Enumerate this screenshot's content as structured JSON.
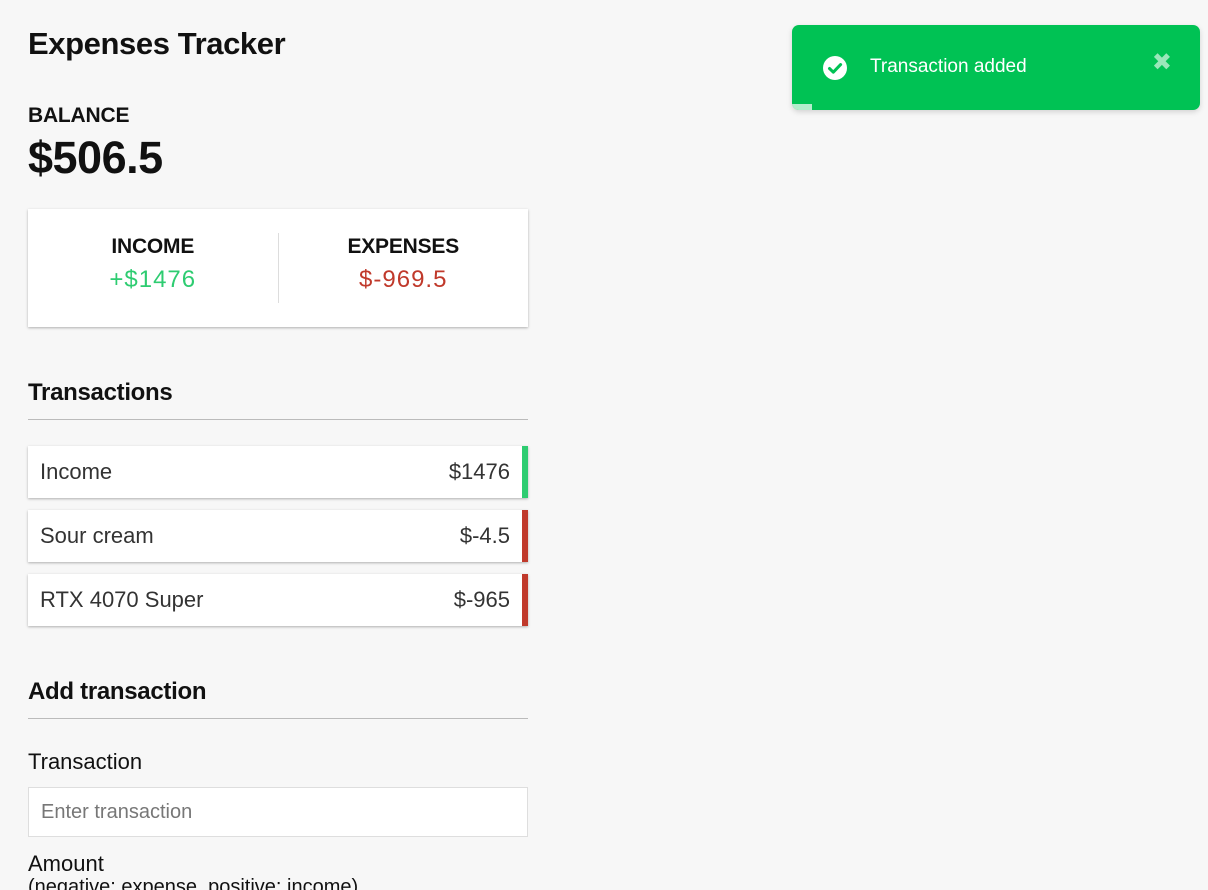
{
  "app": {
    "title": "Expenses Tracker"
  },
  "balance": {
    "label": "BALANCE",
    "value": "$506.5"
  },
  "summary": {
    "income_label": "INCOME",
    "income_value": "+$1476",
    "expenses_label": "EXPENSES",
    "expenses_value": "$-969.5"
  },
  "transactions": {
    "title": "Transactions",
    "items": [
      {
        "name": "Income",
        "amount": "$1476",
        "type": "plus"
      },
      {
        "name": "Sour cream",
        "amount": "$-4.5",
        "type": "minus"
      },
      {
        "name": "RTX 4070 Super",
        "amount": "$-965",
        "type": "minus"
      }
    ]
  },
  "add_form": {
    "title": "Add transaction",
    "transaction_label": "Transaction",
    "transaction_placeholder": "Enter transaction",
    "transaction_value": "",
    "amount_label": "Amount",
    "amount_hint": "(negative: expense, positive: income)"
  },
  "toast": {
    "message": "Transaction added",
    "icon": "check-circle-icon",
    "close_icon": "close-icon",
    "progress_fraction": 0.05
  },
  "colors": {
    "background": "#f7f7f7",
    "income": "#2ecc71",
    "expense": "#c0392b",
    "toast": "#00c254"
  }
}
